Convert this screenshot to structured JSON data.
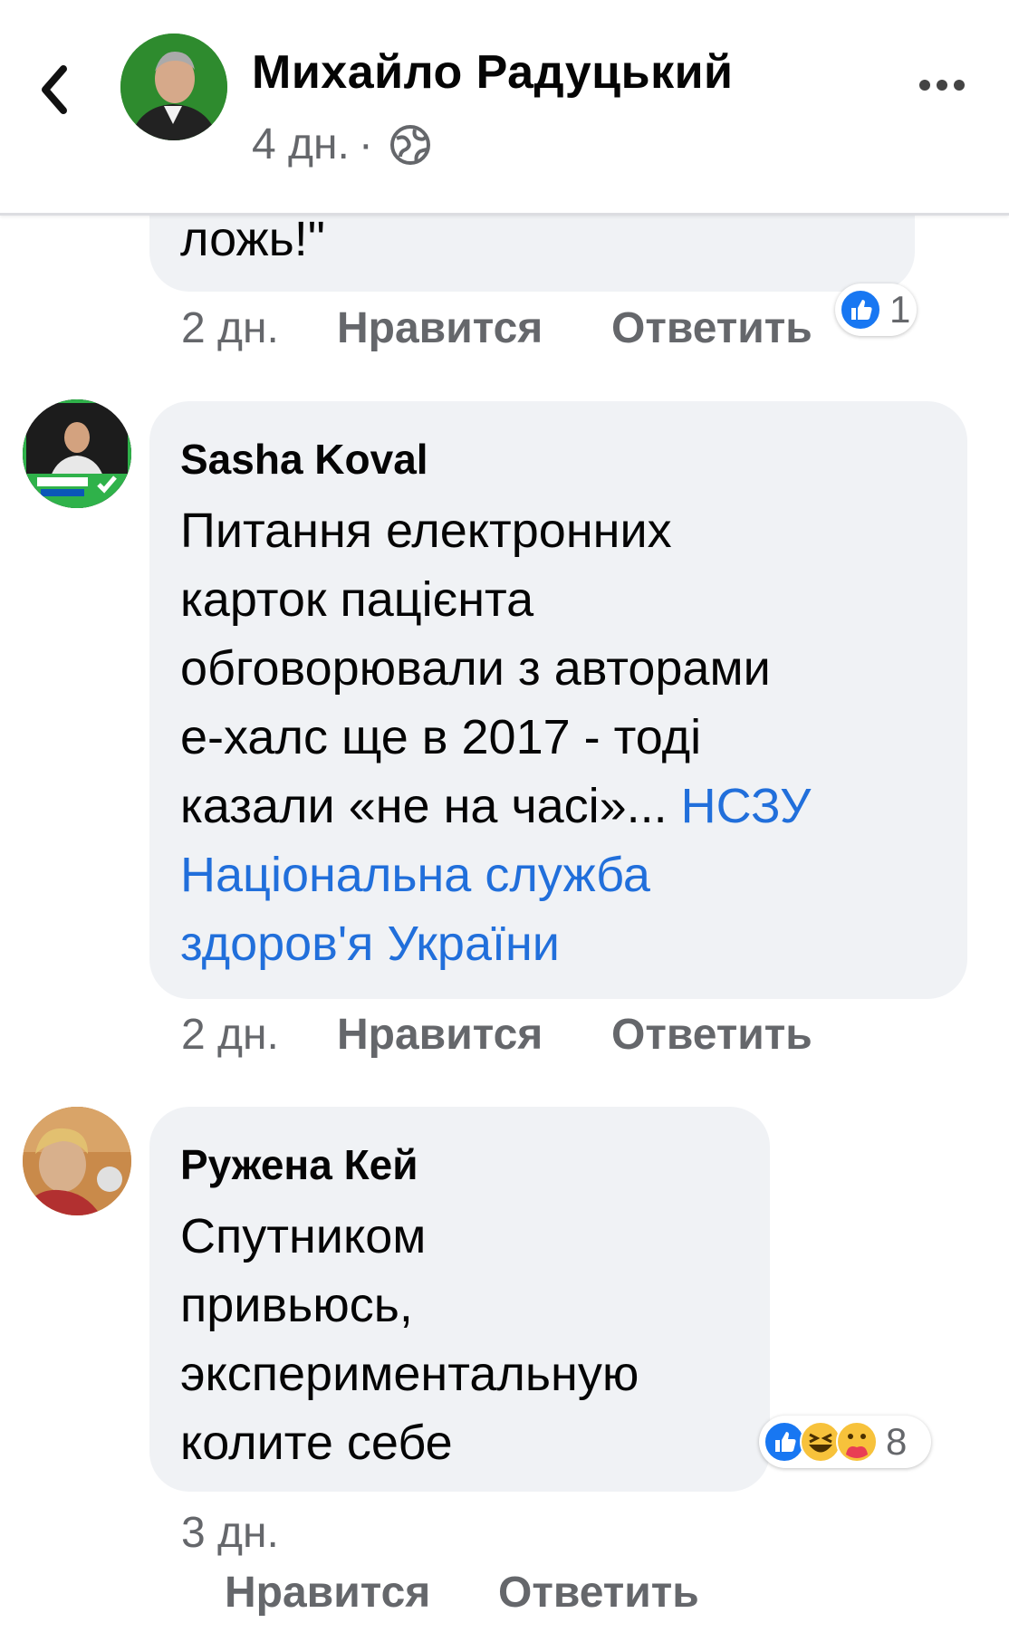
{
  "header": {
    "author_name": "Михайло Радуцький",
    "time": "4 дн.",
    "separator": "·",
    "back_icon": "chevron-left-icon",
    "privacy_icon": "globe-icon",
    "more_icon": "more-horizontal-icon"
  },
  "comments": [
    {
      "text": "ложь!\"",
      "time": "2 дн.",
      "like_label": "Нравится",
      "reply_label": "Ответить",
      "reactions": {
        "icons": [
          "like-icon"
        ],
        "count": "1"
      }
    },
    {
      "author": "Sasha Koval",
      "lines": [
        "Питання електронних",
        "карток пацієнта",
        "обговорювали з авторами",
        "е-халс ще в 2017 - тоді"
      ],
      "last_line_text": "казали «не на часі»... ",
      "link_part1": "НСЗУ",
      "link_line2": "Національна служба",
      "link_line3": "здоров'я України",
      "time": "2 дн.",
      "like_label": "Нравится",
      "reply_label": "Ответить"
    },
    {
      "author": "Ружена Кей",
      "lines": [
        "Спутником",
        "привьюсь,",
        "экспериментальную",
        "колите себе"
      ],
      "time": "3 дн.",
      "like_label": "Нравится",
      "reply_label": "Ответить",
      "reactions": {
        "icons": [
          "like-icon",
          "laugh-icon",
          "care-icon"
        ],
        "count": "8"
      }
    }
  ],
  "colors": {
    "link": "#216fdb",
    "bubble": "#f0f2f5",
    "meta_text": "#65676b",
    "like_blue": "#1877f2",
    "header_avatar_bg": "#2e8b2e"
  }
}
